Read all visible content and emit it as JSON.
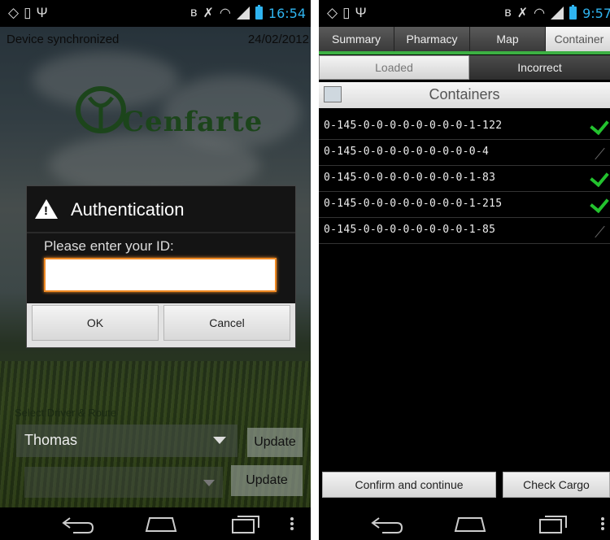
{
  "left": {
    "status": {
      "time": "16:54",
      "icons_left": [
        "location-icon",
        "vibrate-icon",
        "usb-icon"
      ],
      "icons_right": [
        "bluetooth-icon",
        "mute-icon",
        "wifi-icon",
        "signal-icon",
        "battery-icon"
      ]
    },
    "sync_text": "Device synchronized",
    "date": "24/02/2012",
    "logo_text": "Cenfarte",
    "dialog": {
      "title": "Authentication",
      "prompt": "Please enter your ID:",
      "input_value": "",
      "ok_label": "OK",
      "cancel_label": "Cancel"
    },
    "select_label": "Select Driver & Route",
    "driver_value": "Thomas",
    "route_value": "",
    "update_label_1": "Update",
    "update_label_2": "Update"
  },
  "right": {
    "status": {
      "time": "9:57"
    },
    "tabs": [
      {
        "label": "Summary"
      },
      {
        "label": "Pharmacy"
      },
      {
        "label": "Map"
      },
      {
        "label": "Container"
      }
    ],
    "subtabs": {
      "loaded": "Loaded",
      "incorrect": "Incorrect"
    },
    "list_title": "Containers",
    "containers": [
      {
        "code": "0-145-0-0-0-0-0-0-0-0-1-122",
        "status": "checked"
      },
      {
        "code": "0-145-0-0-0-0-0-0-0-0-0-4",
        "status": "unchecked"
      },
      {
        "code": "0-145-0-0-0-0-0-0-0-0-1-83",
        "status": "checked"
      },
      {
        "code": "0-145-0-0-0-0-0-0-0-0-1-215",
        "status": "checked"
      },
      {
        "code": "0-145-0-0-0-0-0-0-0-0-1-85",
        "status": "unchecked"
      }
    ],
    "confirm_label": "Confirm and continue",
    "check_cargo_label": "Check Cargo"
  },
  "colors": {
    "accent_blue": "#2fb4f0",
    "accent_green": "#3cb043",
    "input_focus": "#f08a24",
    "check_green": "#23c22e"
  }
}
